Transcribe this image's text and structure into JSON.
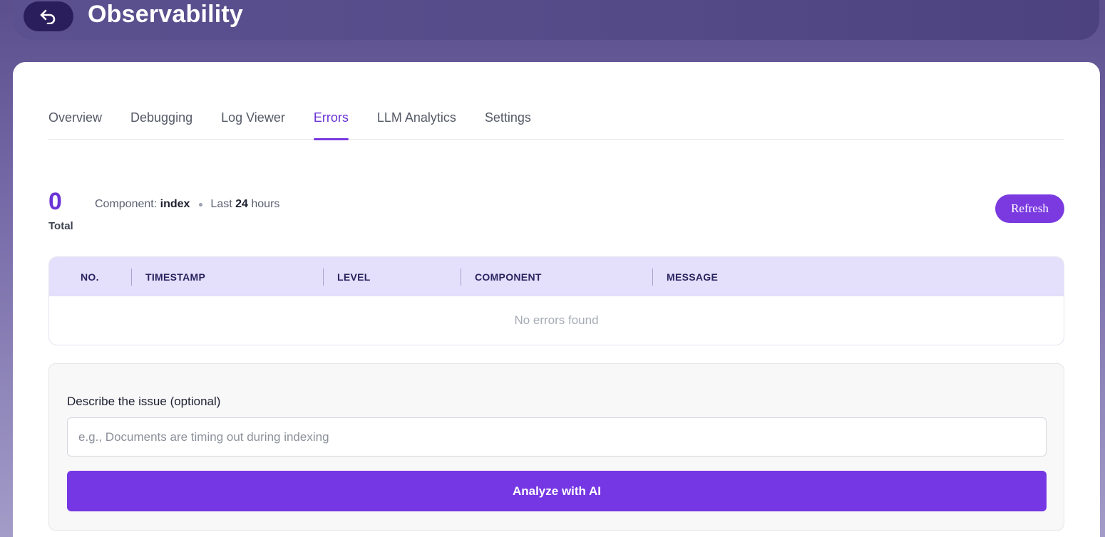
{
  "header": {
    "title": "Observability",
    "back_icon": "back-arrow-icon"
  },
  "tabs": [
    {
      "label": "Overview",
      "active": false
    },
    {
      "label": "Debugging",
      "active": false
    },
    {
      "label": "Log Viewer",
      "active": false
    },
    {
      "label": "Errors",
      "active": true
    },
    {
      "label": "LLM Analytics",
      "active": false
    },
    {
      "label": "Settings",
      "active": false
    }
  ],
  "stats": {
    "total_value": "0",
    "total_label": "Total",
    "component_prefix": "Component:",
    "component_value": "index",
    "range_prefix": "Last",
    "range_value": "24",
    "range_suffix": "hours"
  },
  "refresh_label": "Refresh",
  "table": {
    "columns": [
      "NO.",
      "TIMESTAMP",
      "LEVEL",
      "COMPONENT",
      "MESSAGE"
    ],
    "empty_text": "No errors found"
  },
  "analyze": {
    "label": "Describe the issue (optional)",
    "placeholder": "e.g., Documents are timing out during indexing",
    "value": "",
    "button_label": "Analyze with AI"
  },
  "colors": {
    "accent": "#7a3ae0",
    "table_header_bg": "#e4dffb",
    "header_bg": "#544a88"
  }
}
